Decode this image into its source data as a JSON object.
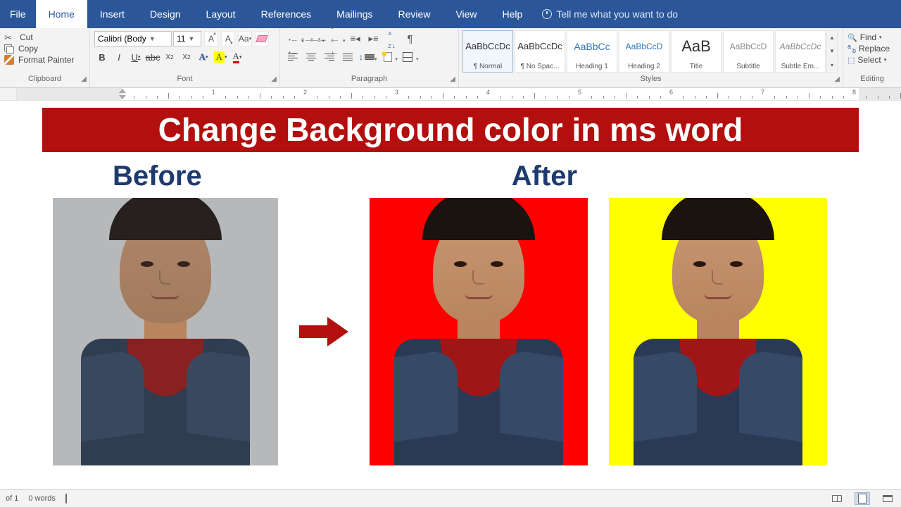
{
  "tabs": [
    "File",
    "Home",
    "Insert",
    "Design",
    "Layout",
    "References",
    "Mailings",
    "Review",
    "View",
    "Help"
  ],
  "active_tab": "Home",
  "tell_me": "Tell me what you want to do",
  "clipboard": {
    "cut": "Cut",
    "copy": "Copy",
    "painter": "Format Painter",
    "label": "Clipboard"
  },
  "font": {
    "name": "Calibri (Body",
    "size": "11",
    "label": "Font"
  },
  "paragraph": {
    "label": "Paragraph"
  },
  "styles": {
    "label": "Styles",
    "items": [
      {
        "sample": "AaBbCcDc",
        "name": "¶ Normal",
        "cls": ""
      },
      {
        "sample": "AaBbCcDc",
        "name": "¶ No Spac...",
        "cls": ""
      },
      {
        "sample": "AaBbCc",
        "name": "Heading 1",
        "cls": "h1s"
      },
      {
        "sample": "AaBbCcD",
        "name": "Heading 2",
        "cls": "h2s"
      },
      {
        "sample": "AaB",
        "name": "Title",
        "cls": "titles"
      },
      {
        "sample": "AaBbCcD",
        "name": "Subtitle",
        "cls": "subtitles"
      },
      {
        "sample": "AaBbCcDc",
        "name": "Subtle Em...",
        "cls": "subtems"
      }
    ]
  },
  "editing": {
    "find": "Find",
    "replace": "Replace",
    "select": "Select",
    "label": "Editing"
  },
  "document": {
    "title": "Change Background color in ms word",
    "before": "Before",
    "after": "After"
  },
  "status": {
    "page": "of 1",
    "words": "0 words"
  }
}
